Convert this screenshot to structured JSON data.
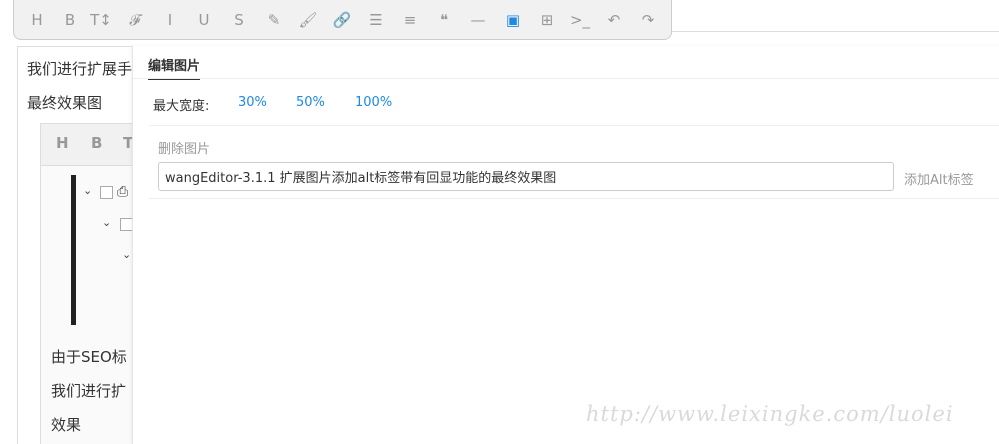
{
  "toolbar": {
    "buttons": [
      {
        "name": "heading-button",
        "icon": "H"
      },
      {
        "name": "bold-button",
        "icon": "B"
      },
      {
        "name": "font-size-button",
        "icon": "T↕"
      },
      {
        "name": "font-name-button",
        "icon": "𝓕"
      },
      {
        "name": "italic-button",
        "icon": "I"
      },
      {
        "name": "underline-button",
        "icon": "U"
      },
      {
        "name": "strikethrough-button",
        "icon": "S"
      },
      {
        "name": "fore-color-button",
        "icon": "✎"
      },
      {
        "name": "back-color-button",
        "icon": "🖌"
      },
      {
        "name": "link-button",
        "icon": "🔗"
      },
      {
        "name": "list-button",
        "icon": "☰"
      },
      {
        "name": "justify-button",
        "icon": "≡"
      },
      {
        "name": "quote-button",
        "icon": "❝"
      },
      {
        "name": "divider-button",
        "icon": "—"
      },
      {
        "name": "image-button",
        "icon": "▣",
        "active": true
      },
      {
        "name": "table-button",
        "icon": "⊞"
      },
      {
        "name": "code-button",
        "icon": ">_"
      },
      {
        "name": "undo-button",
        "icon": "↶"
      },
      {
        "name": "redo-button",
        "icon": "↷"
      }
    ]
  },
  "editor": {
    "line1": "我们进行扩展手",
    "line2": "最终效果图",
    "inner_toolbar": [
      "H",
      "B",
      "T"
    ],
    "para1": "由于SEO标",
    "para2": "我们进行扩",
    "para3": "效果"
  },
  "panel": {
    "tab_label": "编辑图片",
    "max_width_label": "最大宽度:",
    "width_options": [
      "30%",
      "50%",
      "100%"
    ],
    "delete_label": "删除图片",
    "alt_input_value": "wangEditor-3.1.1 扩展图片添加alt标签带有回显功能的最终效果图",
    "add_alt_label": "添加Alt标签"
  },
  "watermark": "http://www.leixingke.com/luolei",
  "colors": {
    "accent": "#1e88e5",
    "toolbar_bg": "#f1f1f1"
  }
}
